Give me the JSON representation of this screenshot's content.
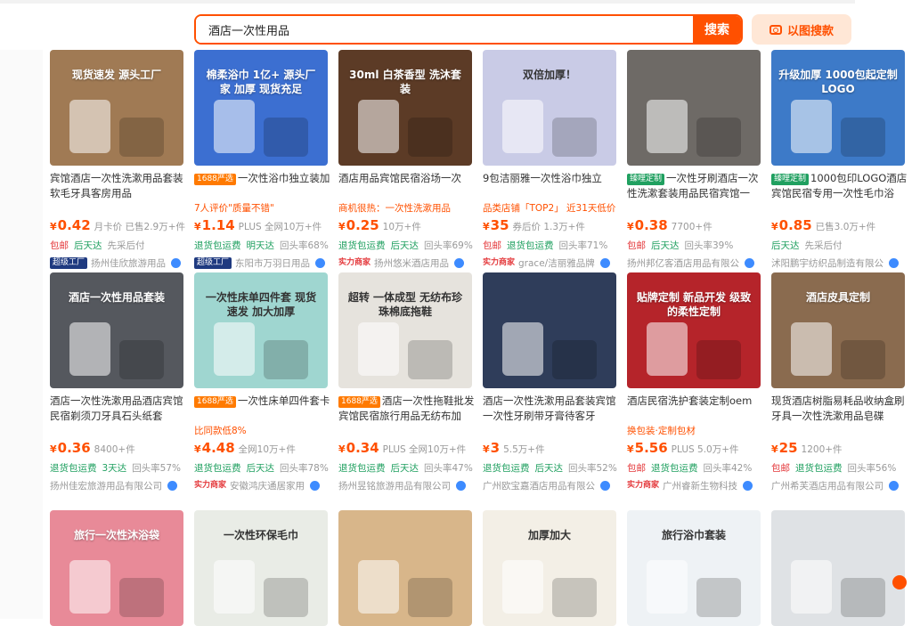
{
  "search": {
    "query": "酒店一次性用品",
    "button_label": "搜索",
    "image_search_label": "以图搜款"
  },
  "row1": [
    {
      "thumb_text": "现货速发 源头工厂",
      "thumb_color": "#a07a54",
      "title_parts": [
        "宾馆",
        "酒店一次性",
        "洗漱",
        "用品",
        "套装软毛牙具客房",
        "用品"
      ],
      "title": "宾馆酒店一次性洗漱用品套装软毛牙具客房用品",
      "sub": "",
      "price": "0.42",
      "meta": "月卡价 已售2.9万+件",
      "badges": [
        "包邮",
        "后天达",
        "先采后付"
      ],
      "shop_badge": "超级工厂",
      "shop": "扬州佳欣旅游用品"
    },
    {
      "thumb_text": "棉柔浴巾 1亿+ 源头厂家 加厚 现货充足",
      "thumb_color": "#3c6fd1",
      "tag": "1688严选",
      "title": "一次性浴巾独立装加",
      "sub": "7人评价\"质量不错\"",
      "price": "1.14",
      "meta": "PLUS 全网10万+件",
      "badges": [
        "退货包运费",
        "明天达",
        "回头率68%"
      ],
      "shop_badge": "超级工厂",
      "shop": "东阳市万羽日用品"
    },
    {
      "thumb_text": "30ml 白茶香型 洗沐套装",
      "thumb_color": "#5c3b26",
      "title": "酒店用品宾馆民宿浴场一次",
      "sub": "商机很热：一次性洗漱用品",
      "price": "0.25",
      "meta": "10万+件",
      "badges": [
        "退货包运费",
        "后天达",
        "回头率69%"
      ],
      "shop_badge": "实力商家",
      "shop": "扬州悠米酒店用品"
    },
    {
      "thumb_text": "双倍加厚！",
      "thumb_color": "#c9cbe6",
      "title": "9包洁丽雅一次性浴巾独立",
      "sub": "品类店铺「TOP2」 近31天低价",
      "price": "35",
      "meta": "券后价 1.3万+件",
      "badges": [
        "包邮",
        "退货包运费",
        "回头率71%"
      ],
      "shop_badge": "实力商家",
      "shop": "grace/洁丽雅品牌"
    },
    {
      "thumb_text": "",
      "thumb_color": "#6e6a66",
      "tag": "臻哩定制",
      "title": "一次性牙刷酒店一次性洗漱套装用品民宿宾馆一",
      "sub": "",
      "price": "0.38",
      "meta": "7700+件",
      "badges": [
        "包邮",
        "后天达",
        "回头率39%"
      ],
      "shop_badge": "",
      "shop": "扬州邦亿客酒店用品有限公"
    },
    {
      "thumb_text": "升级加厚 1000包起定制LOGO",
      "thumb_color": "#3d7ac8",
      "tag": "臻哩定制",
      "title": "1000包印LOGO酒店宾馆民宿专用一次性毛巾浴",
      "sub": "",
      "price": "0.85",
      "meta": "已售3.0万+件",
      "badges": [
        "后天达",
        "先采后付"
      ],
      "shop_badge": "",
      "shop": "沭阳鹏宇纺织品制造有限公"
    }
  ],
  "row2": [
    {
      "thumb_text": "酒店一次性用品套装",
      "thumb_color": "#55585e",
      "title": "酒店一次性洗漱用品酒店宾馆民宿剃须刀牙具石头纸套",
      "sub": "",
      "price": "0.36",
      "meta": "8400+件",
      "badges": [
        "退货包运费",
        "3天达",
        "回头率57%"
      ],
      "shop_badge": "",
      "shop": "扬州佳宏旅游用品有限公司"
    },
    {
      "thumb_text": "一次性床单四件套 现货速发 加大加厚",
      "thumb_color": "#9fd6d0",
      "tag": "1688严选",
      "title": "一次性床单四件套卡",
      "sub": "比同款低8%",
      "price": "4.48",
      "meta": "全网10万+件",
      "badges": [
        "退货包运费",
        "后天达",
        "回头率78%"
      ],
      "shop_badge": "实力商家",
      "shop": "安徽鸿庆通居家用"
    },
    {
      "thumb_text": "超转 一体成型 无纺布珍珠棉底拖鞋",
      "thumb_color": "#e6e3dd",
      "tag": "1688严选",
      "title": "酒店一次性拖鞋批发宾馆民宿旅行用品无纺布加",
      "sub": "",
      "price": "0.34",
      "meta": "PLUS 全网10万+件",
      "badges": [
        "退货包运费",
        "后天达",
        "回头率47%"
      ],
      "shop_badge": "",
      "shop": "扬州昱铭旅游用品有限公司"
    },
    {
      "thumb_text": "",
      "thumb_color": "#2f3d5a",
      "title": "酒店一次性洗漱用品套装宾馆一次性牙刷带牙膏待客牙",
      "sub": "",
      "price": "3",
      "meta": "5.5万+件",
      "badges": [
        "退货包运费",
        "后天达",
        "回头率52%"
      ],
      "shop_badge": "",
      "shop": "广州欧宝嘉酒店用品有限公"
    },
    {
      "thumb_text": "贴牌定制 新品开发 级致的柔性定制",
      "thumb_color": "#b5242a",
      "title": "酒店民宿洗护套装定制oem",
      "sub": "换包装·定制包材",
      "price": "5.56",
      "meta": "PLUS 5.0万+件",
      "badges": [
        "包邮",
        "退货包运费",
        "回头率42%"
      ],
      "shop_badge": "实力商家",
      "shop": "广州睿新生物科技"
    },
    {
      "thumb_text": "酒店皮具定制",
      "thumb_color": "#8a6b4f",
      "title": "现货酒店树脂易耗品收纳盒刷牙具一次性洗漱用品皂碟",
      "sub": "",
      "price": "25",
      "meta": "1200+件",
      "badges": [
        "包邮",
        "退货包运费",
        "回头率56%"
      ],
      "shop_badge": "",
      "shop": "广州希芙酒店用品有限公司"
    }
  ],
  "row3": [
    {
      "thumb_text": "旅行一次性沐浴袋",
      "thumb_color": "#e88a98"
    },
    {
      "thumb_text": "一次性环保毛巾",
      "thumb_color": "#e9ece6"
    },
    {
      "thumb_text": "",
      "thumb_color": "#d8b68a"
    },
    {
      "thumb_text": "加厚加大",
      "thumb_color": "#f3efe6"
    },
    {
      "thumb_text": "旅行浴巾套装",
      "thumb_color": "#eef2f5"
    },
    {
      "thumb_text": "",
      "thumb_color": "#dfe2e5"
    }
  ]
}
